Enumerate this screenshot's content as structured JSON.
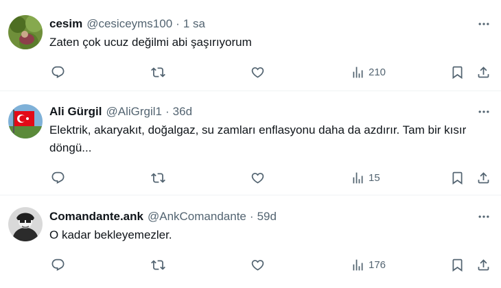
{
  "tweets": [
    {
      "name": "cesim",
      "handle": "@cesiceyms100",
      "separator": "·",
      "time": "1 sa",
      "text": "Zaten çok ucuz değilmi abi şaşırıyorum",
      "views": "210"
    },
    {
      "name": "Ali Gürgil",
      "handle": "@AliGrgil1",
      "separator": "·",
      "time": "36d",
      "text": "Elektrik, akaryakıt, doğalgaz, su zamları enflasyonu daha da azdırır. Tam bir kısır döngü...",
      "views": "15"
    },
    {
      "name": "Comandante.ank",
      "handle": "@AnkComandante",
      "separator": "·",
      "time": "59d",
      "text": "O kadar bekleyemezler.",
      "views": "176"
    }
  ],
  "icons": {
    "reply": "reply-icon",
    "retweet": "retweet-icon",
    "like": "heart-icon",
    "views": "bar-chart-icon",
    "bookmark": "bookmark-icon",
    "share": "share-icon",
    "more": "more-icon"
  },
  "colors": {
    "text": "#0f1419",
    "secondary": "#536471",
    "divider": "#eff3f4"
  }
}
